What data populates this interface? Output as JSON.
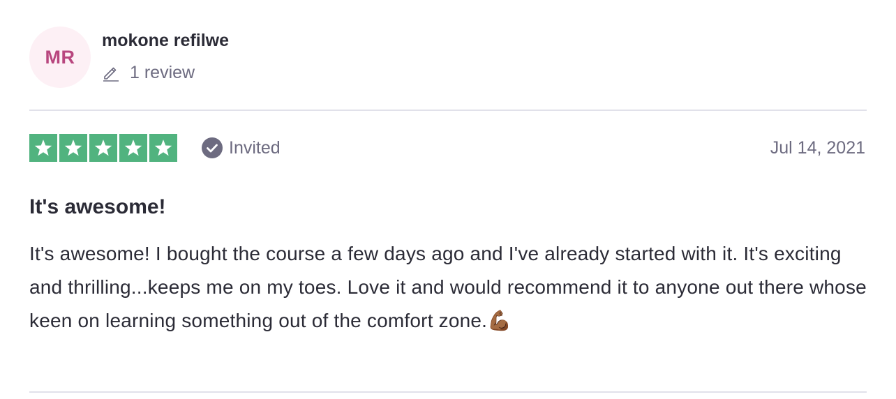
{
  "reviewer": {
    "initials": "MR",
    "name": "mokone refilwe",
    "review_count": "1 review"
  },
  "review": {
    "rating_stars": 5,
    "rating_max": 5,
    "invited_label": "Invited",
    "date": "Jul 14, 2021",
    "title": "It's awesome!",
    "body": "It's awesome! I bought the course a few days ago and I've already started with it. It's exciting and thrilling...keeps me on my toes. Love it and would recommend it to anyone out there whose keen on learning something out of the comfort zone.💪🏾"
  },
  "colors": {
    "star_green": "#51b37f",
    "avatar_bg": "#fdf0f5",
    "avatar_text": "#b8467e",
    "muted_text": "#6d6b80"
  },
  "icons": {
    "pencil": "pencil-icon",
    "check": "check-circle-icon",
    "star": "star-icon"
  }
}
